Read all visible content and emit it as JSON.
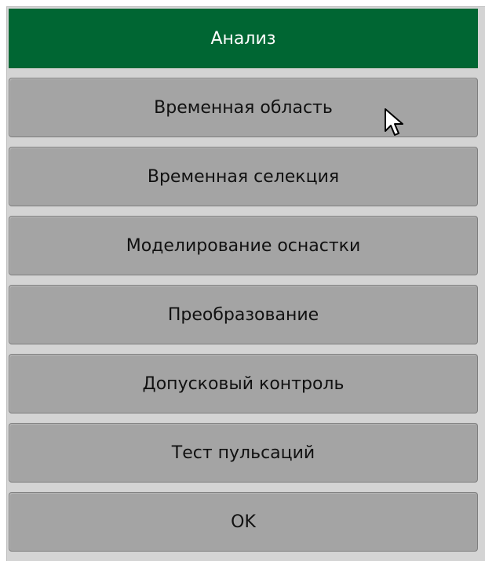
{
  "menu": {
    "title": "Анализ",
    "items": [
      {
        "label": "Временная область"
      },
      {
        "label": "Временная селекция"
      },
      {
        "label": "Моделирование оснастки"
      },
      {
        "label": "Преобразование"
      },
      {
        "label": "Допусковый контроль"
      },
      {
        "label": "Тест пульсаций"
      },
      {
        "label": "OK"
      }
    ]
  },
  "icons": {
    "pointer": "mouse-pointer-icon"
  },
  "colors": {
    "header_bg": "#006633",
    "button_bg": "#a4a4a4",
    "panel_bg": "#d4d4d4"
  }
}
